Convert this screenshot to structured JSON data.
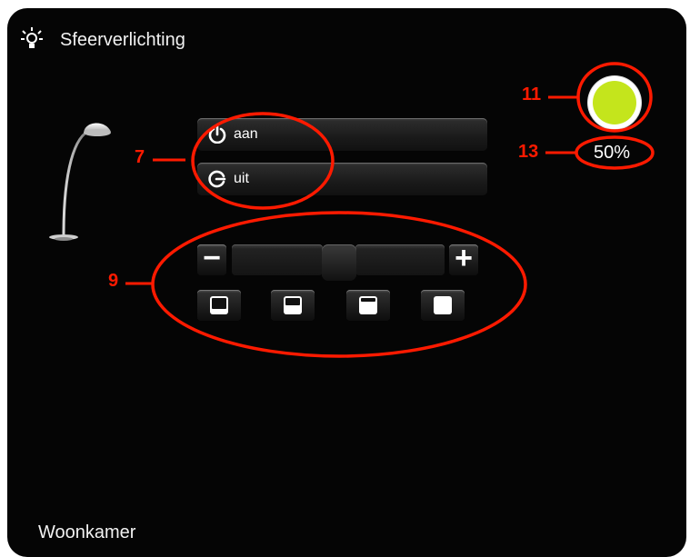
{
  "widget": {
    "title": "Sfeerverlichting",
    "room": "Woonkamer"
  },
  "buttons": {
    "on_label": "aan",
    "off_label": "uit"
  },
  "dimmer": {
    "level_percent": 50,
    "level_text": "50%",
    "minus_label": "−",
    "plus_label": "+",
    "presets": [
      "25%",
      "50%",
      "75%",
      "100%"
    ]
  },
  "status": {
    "lamp_color": "#c4e51c"
  },
  "callouts": [
    "7",
    "9",
    "11",
    "13"
  ],
  "colors": {
    "panel": "#050505",
    "annotation": "#ff1a00"
  }
}
